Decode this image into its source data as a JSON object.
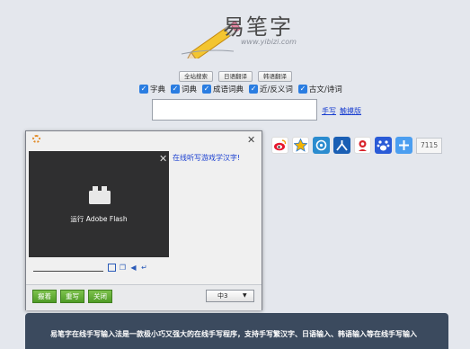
{
  "logo": {
    "title": "易笔字",
    "url": "www.yibizi.com"
  },
  "modes": [
    "全站搜索",
    "日语翻译",
    "韩语翻译"
  ],
  "checks": [
    "字典",
    "词典",
    "成语词典",
    "近/反义词",
    "古文/诗词"
  ],
  "search": {
    "placeholder": ""
  },
  "links": {
    "handwriting": "手写",
    "touch": "触摸版"
  },
  "share": {
    "icons": [
      "weibo-icon",
      "qzone-icon",
      "tencent-weibo-icon",
      "renren-icon",
      "douban-icon",
      "baidu-icon",
      "more-share-icon"
    ],
    "count": "7115"
  },
  "popup": {
    "flash_label": "运行 Adobe Flash",
    "online_link": "在线听写游戏学汉字!",
    "buttons": [
      "搬着",
      "重写",
      "关闭"
    ],
    "lang": "中3"
  },
  "info": {
    "text": "易笔字在线手写输入法是一款极小巧又强大的在线手写程序，支持手写繁汉字、日语输入、韩语输入等在线手写输入"
  },
  "colors": {
    "accent": "#2a7de1",
    "link": "#1a3fd0",
    "green_button": "#4f9b26",
    "info_bg": "#3b4a5e"
  }
}
